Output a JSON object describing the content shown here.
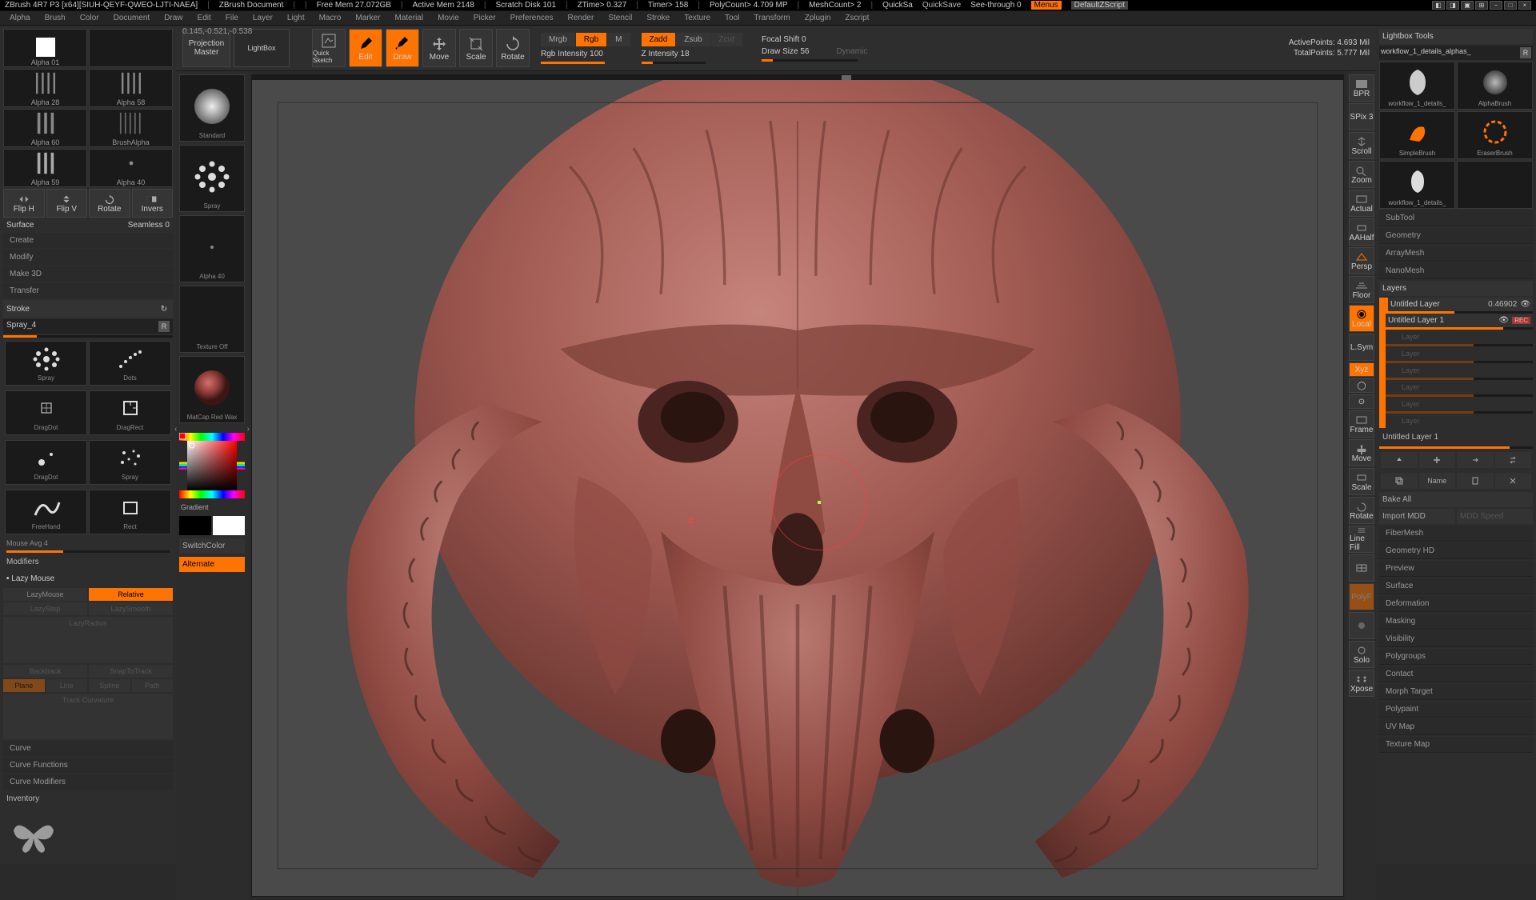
{
  "titlebar": {
    "app": "ZBrush 4R7 P3 [x64][SIUH-QEYF-QWEO-LJTI-NAEA]",
    "doc": "ZBrush Document",
    "freemem": "Free Mem 27.072GB",
    "activemem": "Active Mem 2148",
    "scratch": "Scratch Disk 101",
    "ztime": "ZTime> 0.327",
    "timer": "Timer> 158",
    "polycount": "PolyCount> 4.709 MP",
    "meshcount": "MeshCount> 2",
    "quicksa": "QuickSa",
    "quicksave": "QuickSave",
    "seethrough": "See-through 0",
    "menus": "Menus",
    "defaultscript": "DefaultZScript"
  },
  "menubar": [
    "Alpha",
    "Brush",
    "Color",
    "Document",
    "Draw",
    "Edit",
    "File",
    "Layer",
    "Light",
    "Macro",
    "Marker",
    "Material",
    "Movie",
    "Picker",
    "Preferences",
    "Render",
    "Stencil",
    "Stroke",
    "Texture",
    "Tool",
    "Transform",
    "Zplugin",
    "Zscript"
  ],
  "coords": "0.145,-0.521,-0.538",
  "alphas": [
    {
      "label": "Alpha 01",
      "type": "blank"
    },
    {
      "label": "",
      "type": "empty"
    },
    {
      "label": "Alpha 28",
      "type": "lines-v"
    },
    {
      "label": "Alpha 58",
      "type": "lines-v"
    },
    {
      "label": "Alpha 60",
      "type": "lines-v"
    },
    {
      "label": "BrushAlpha",
      "type": "lines-v"
    },
    {
      "label": "Alpha 59",
      "type": "lines-v"
    },
    {
      "label": "Alpha 40",
      "type": "dot"
    }
  ],
  "flip_tools": [
    "Flip H",
    "Flip V",
    "Rotate",
    "Invers"
  ],
  "surface": "Surface",
  "seamless": "Seamless 0",
  "create_list": [
    "Create",
    "Modify",
    "Make 3D",
    "Transfer"
  ],
  "stroke": {
    "header": "Stroke",
    "spray": "Spray_4",
    "r": "R",
    "presets": [
      {
        "label": "Spray",
        "type": "dots"
      },
      {
        "label": "Dots",
        "type": "dotsline"
      },
      {
        "label": "DragDot",
        "type": "dragdot"
      },
      {
        "label": "DragRect",
        "type": "dragrect"
      },
      {
        "label": "DragDot",
        "type": "dragdot2"
      },
      {
        "label": "Spray",
        "type": "dots2"
      },
      {
        "label": "FreeHand",
        "type": "freehand"
      },
      {
        "label": "Rect",
        "type": "rect"
      }
    ],
    "mouseavg": "Mouse Avg 4",
    "modifiers": "Modifiers",
    "lazymouse": "Lazy Mouse",
    "lazymouse_btn": "LazyMouse",
    "relative": "Relative",
    "lazystep": "LazyStep",
    "lazysmooth": "LazySmooth",
    "lazyradius": "LazyRadius",
    "backtrack": "Backtrack",
    "snaptotrack": "SnapToTrack",
    "opts": [
      "Plane",
      "Line",
      "Spline",
      "Path"
    ],
    "trackcurv": "Track Curvature",
    "curve": "Curve",
    "curvefn": "Curve Functions",
    "curvemod": "Curve Modifiers",
    "inventory": "Inventory"
  },
  "brushcol": {
    "standard": "Standard",
    "spray": "Spray",
    "alpha40": "Alpha 40",
    "texoff": "Texture Off",
    "matcap": "MatCap Red Wax",
    "gradient": "Gradient",
    "switchcolor": "SwitchColor",
    "alternate": "Alternate"
  },
  "toolbar": {
    "projection": "Projection Master",
    "lightbox": "LightBox",
    "quicksketch": "Quick Sketch",
    "edit": "Edit",
    "draw": "Draw",
    "move": "Move",
    "scale": "Scale",
    "rotate": "Rotate",
    "mrgb": "Mrgb",
    "rgb": "Rgb",
    "m": "M",
    "rgbint": "Rgb Intensity 100",
    "zadd": "Zadd",
    "zsub": "Zsub",
    "zcut": "Zcut",
    "zint": "Z Intensity 18",
    "focalshift": "Focal Shift 0",
    "drawsize": "Draw Size 56",
    "dynamic": "Dynamic",
    "activepts": "ActivePoints: 4.693 Mil",
    "totalpts": "TotalPoints: 5.777 Mil"
  },
  "righttools": [
    "BPR",
    "SPix 3",
    "Scroll",
    "Zoom",
    "Actual",
    "AAHalf",
    "Persp",
    "Floor",
    "Local",
    "L.Sym",
    "Xyz",
    "",
    "",
    "Frame",
    "Move",
    "Scale",
    "Rotate",
    "Line Fill",
    "",
    "PolyF",
    "",
    "Solo",
    "Xpose"
  ],
  "rightpanel": {
    "header": "Lightbox Tools",
    "file": "workflow_1_details_alphas_",
    "tools": [
      "workflow_1_details_",
      "AlphaBrush",
      "SimpleBrush",
      "EraserBrush",
      "workflow_1_details_"
    ],
    "sections": [
      "SubTool",
      "Geometry",
      "ArrayMesh",
      "NanoMesh"
    ],
    "layers": "Layers",
    "layer1": {
      "name": "Untitled Layer",
      "val": "0.46902"
    },
    "layer2": "Untitled Layer 1",
    "dimlayers": [
      "Layer",
      "Layer",
      "Layer",
      "Layer",
      "Layer",
      "Layer"
    ],
    "currentlayer": "Untitled Layer 1",
    "name_btn": "Name",
    "bakeall": "Bake All",
    "importmdd": "Import MDD",
    "mddspeed": "MDD Speed",
    "bottom": [
      "FiberMesh",
      "Geometry HD",
      "Preview",
      "Surface",
      "Deformation",
      "Masking",
      "Visibility",
      "Polygroups",
      "Contact",
      "Morph Target",
      "Polypaint",
      "UV Map",
      "Texture Map"
    ]
  }
}
